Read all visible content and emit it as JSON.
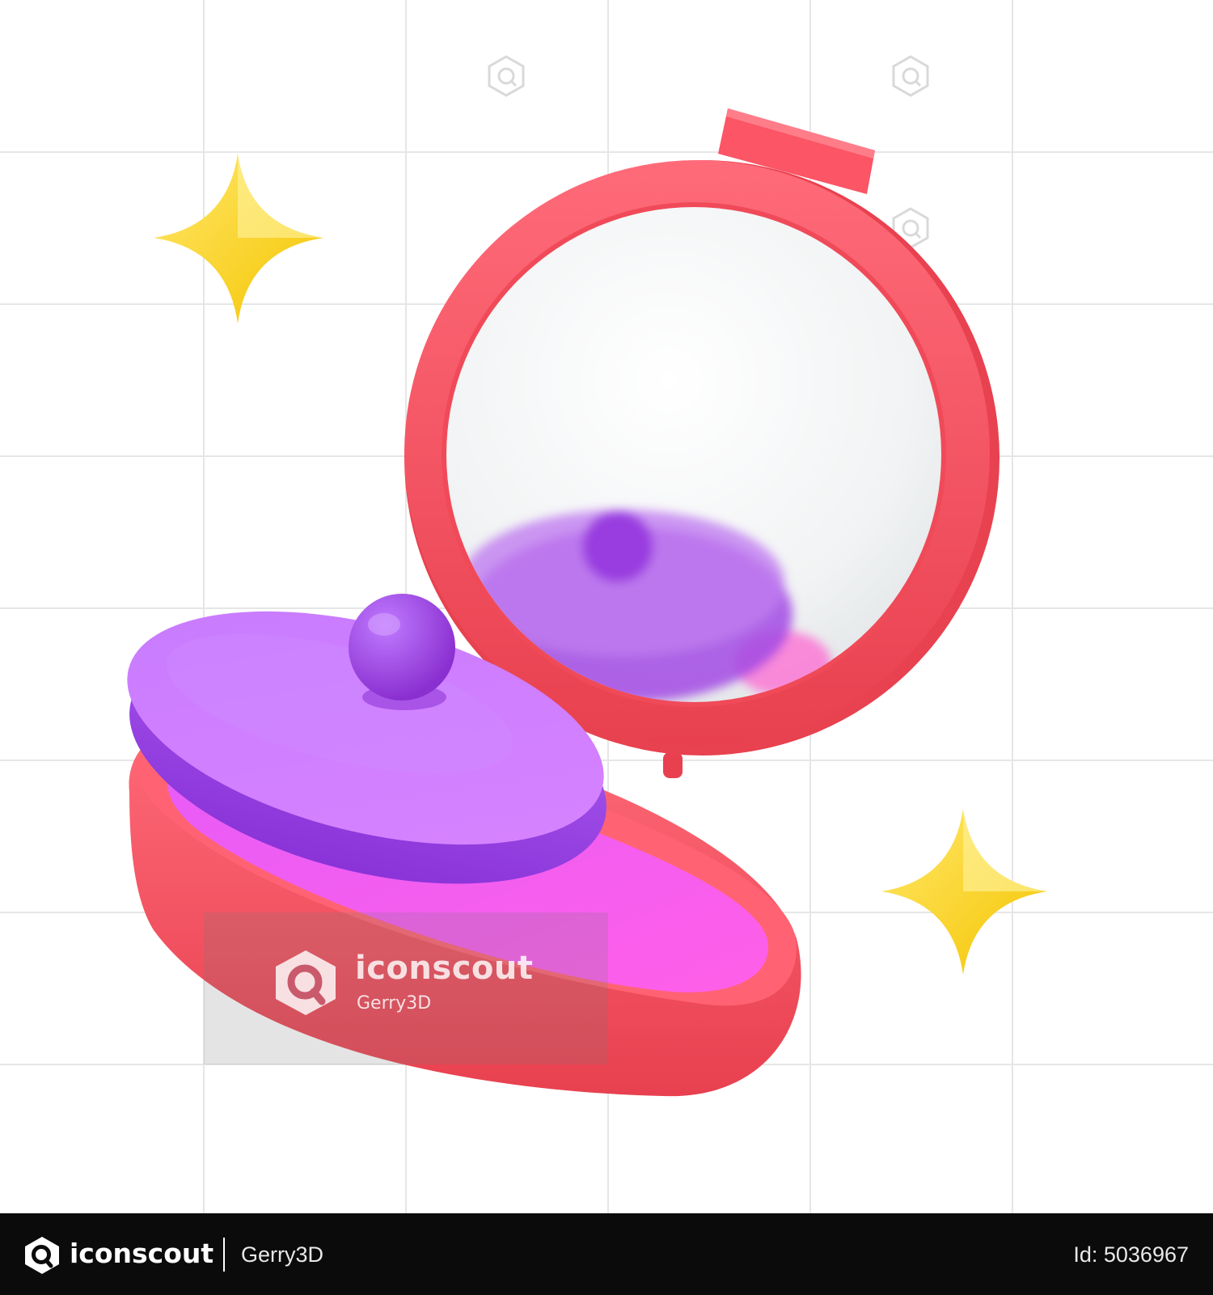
{
  "watermark": {
    "brand": "iconscout",
    "author": "Gerry3D"
  },
  "footer": {
    "brand": "iconscout",
    "author": "Gerry3D",
    "id_label": "Id: 5036967"
  },
  "colors": {
    "background": "#ffffff",
    "grid": "#e6e6e6",
    "compact_case": "#fb5566",
    "powder_pan": "#f25cf6",
    "puff": "#c46bff",
    "puff_knob": "#a243dd",
    "mirror_glass": "#f2f4f5",
    "sparkle": "#ffd21f",
    "footer_bg": "#0b0b0b"
  },
  "icons": {
    "logo": "iconscout-logo-icon",
    "sparkle": "four-point-star-icon"
  }
}
